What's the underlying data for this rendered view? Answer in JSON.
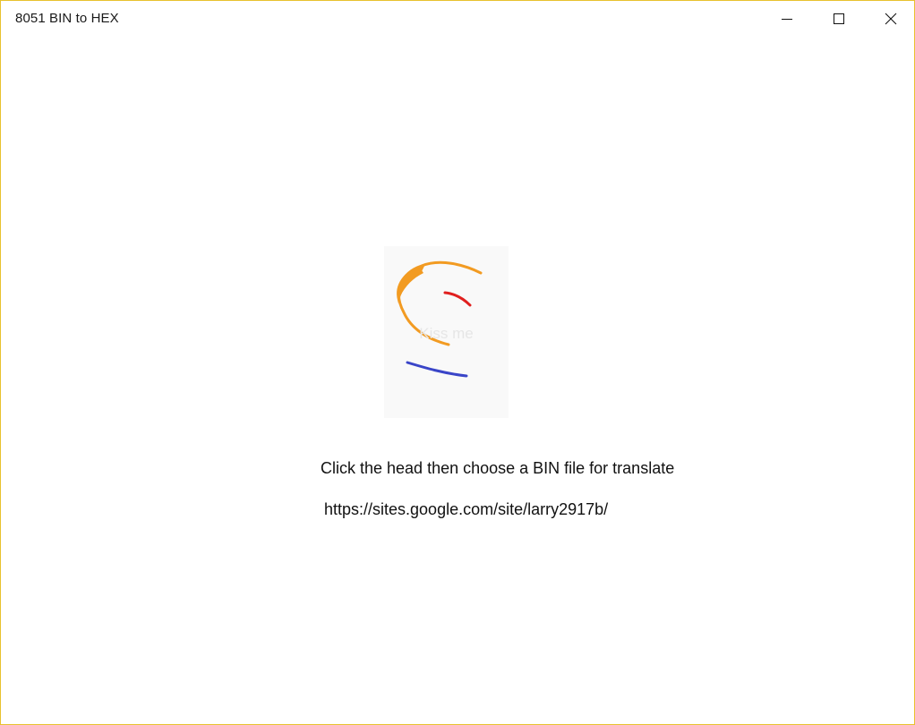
{
  "window": {
    "title": "8051 BIN to HEX",
    "border_color": "#e8c12e",
    "controls": {
      "minimize_icon": "minimize-icon",
      "maximize_icon": "maximize-icon",
      "close_icon": "close-icon"
    }
  },
  "main": {
    "head_button": {
      "label": "Kiss me",
      "icon": "face-drawing-icon",
      "colors": {
        "hair": "#f29b22",
        "eye": "#e0201f",
        "mouth": "#3a45c8"
      }
    },
    "instruction": "Click the head then choose a BIN file for translate",
    "link": "https://sites.google.com/site/larry2917b/"
  }
}
